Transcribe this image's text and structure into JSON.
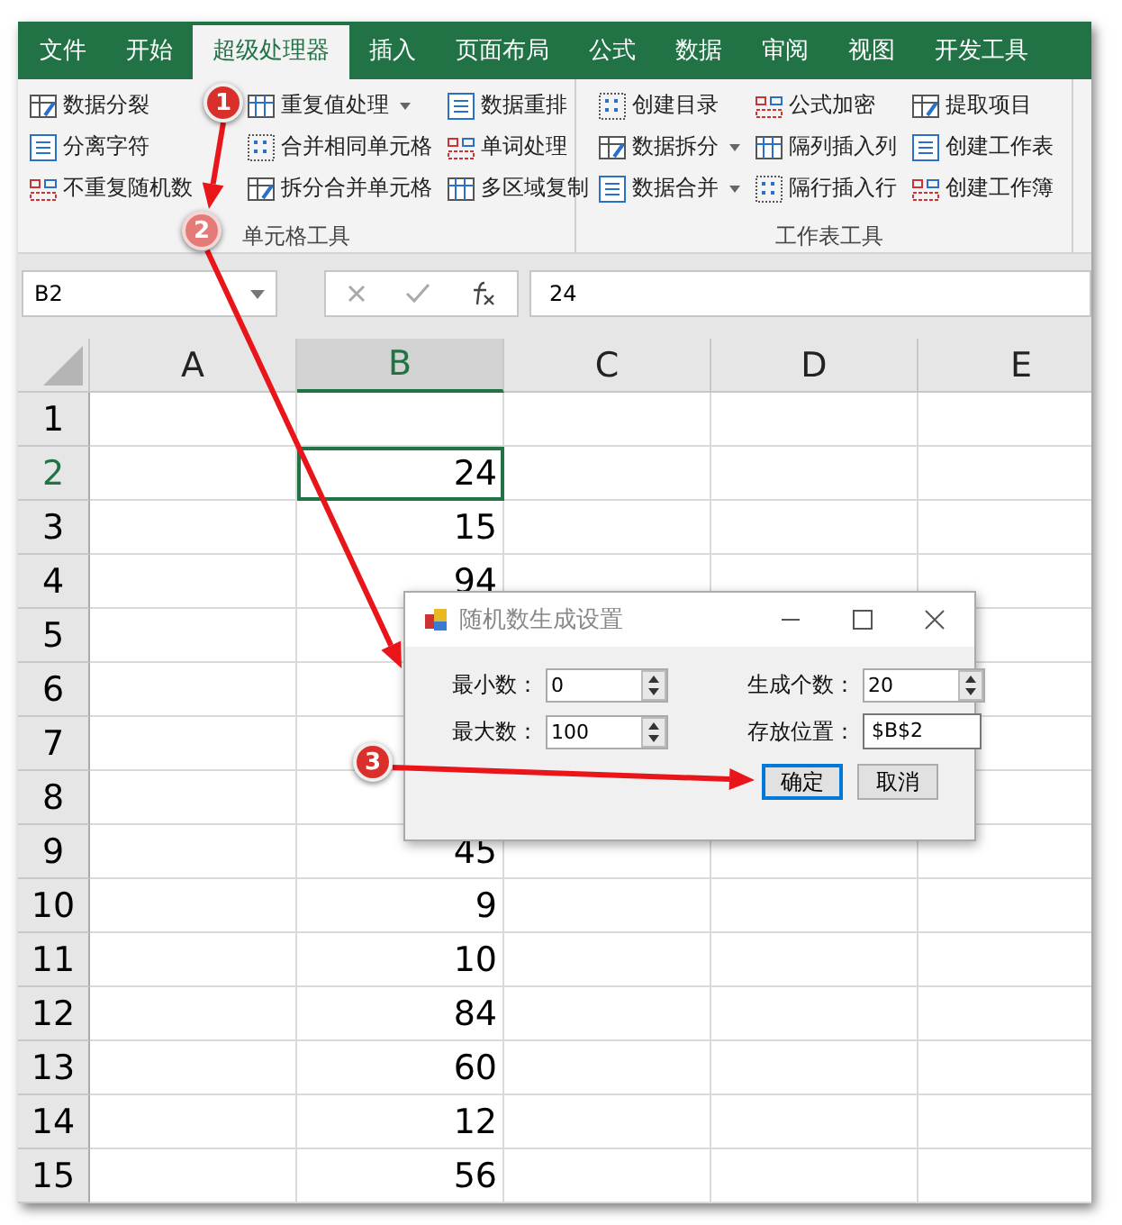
{
  "ribbon": {
    "tabs": [
      {
        "label": "文件",
        "selected": false
      },
      {
        "label": "开始",
        "selected": false
      },
      {
        "label": "超级处理器",
        "selected": true
      },
      {
        "label": "插入",
        "selected": false
      },
      {
        "label": "页面布局",
        "selected": false
      },
      {
        "label": "公式",
        "selected": false
      },
      {
        "label": "数据",
        "selected": false
      },
      {
        "label": "审阅",
        "selected": false
      },
      {
        "label": "视图",
        "selected": false
      },
      {
        "label": "开发工具",
        "selected": false
      }
    ],
    "groups": [
      {
        "label": "单元格工具",
        "columns": [
          [
            {
              "label": "数据分裂",
              "dropdown": false
            },
            {
              "label": "分离字符",
              "dropdown": false
            },
            {
              "label": "不重复随机数",
              "dropdown": false
            }
          ],
          [
            {
              "label": "重复值处理",
              "dropdown": true
            },
            {
              "label": "合并相同单元格",
              "dropdown": false
            },
            {
              "label": "拆分合并单元格",
              "dropdown": false
            }
          ],
          [
            {
              "label": "数据重排",
              "dropdown": false
            },
            {
              "label": "单词处理",
              "dropdown": false
            },
            {
              "label": "多区域复制",
              "dropdown": false
            }
          ]
        ]
      },
      {
        "label": "工作表工具",
        "columns": [
          [
            {
              "label": "创建目录",
              "dropdown": false
            },
            {
              "label": "数据拆分",
              "dropdown": true
            },
            {
              "label": "数据合并",
              "dropdown": true
            }
          ],
          [
            {
              "label": "公式加密",
              "dropdown": false
            },
            {
              "label": "隔列插入列",
              "dropdown": false
            },
            {
              "label": "隔行插入行",
              "dropdown": false
            }
          ],
          [
            {
              "label": "提取项目",
              "dropdown": false
            },
            {
              "label": "创建工作表",
              "dropdown": false
            },
            {
              "label": "创建工作簿",
              "dropdown": false
            }
          ]
        ]
      }
    ]
  },
  "formula_bar": {
    "name_box": "B2",
    "formula": "24"
  },
  "sheet": {
    "columns": [
      {
        "label": "A",
        "selected": false
      },
      {
        "label": "B",
        "selected": true
      },
      {
        "label": "C",
        "selected": false
      },
      {
        "label": "D",
        "selected": false
      },
      {
        "label": "E",
        "selected": false
      }
    ],
    "rows": [
      {
        "number": "1",
        "selected": false
      },
      {
        "number": "2",
        "b": "24",
        "selected": true
      },
      {
        "number": "3",
        "b": "15",
        "selected": false
      },
      {
        "number": "4",
        "b": "94",
        "selected": false
      },
      {
        "number": "5",
        "selected": false
      },
      {
        "number": "6",
        "selected": false
      },
      {
        "number": "7",
        "selected": false
      },
      {
        "number": "8",
        "selected": false
      },
      {
        "number": "9",
        "b": "45",
        "selected": false
      },
      {
        "number": "10",
        "b": "9",
        "selected": false
      },
      {
        "number": "11",
        "b": "10",
        "selected": false
      },
      {
        "number": "12",
        "b": "84",
        "selected": false
      },
      {
        "number": "13",
        "b": "60",
        "selected": false
      },
      {
        "number": "14",
        "b": "12",
        "selected": false
      },
      {
        "number": "15",
        "b": "56",
        "selected": false
      }
    ]
  },
  "dialog": {
    "title": "随机数生成设置",
    "fields": [
      {
        "label": "最小数：",
        "value": "0",
        "kind": "spinner"
      },
      {
        "label": "生成个数：",
        "value": "20",
        "kind": "spinner"
      },
      {
        "label": "最大数：",
        "value": "100",
        "kind": "spinner"
      },
      {
        "label": "存放位置：",
        "value": "$B$2",
        "kind": "text"
      }
    ],
    "buttons": [
      {
        "label": "确定",
        "default": true
      },
      {
        "label": "取消",
        "default": false
      }
    ]
  },
  "annotations": [
    {
      "number": "1",
      "faded": false
    },
    {
      "number": "2",
      "faded": true
    },
    {
      "number": "3",
      "faded": false
    }
  ]
}
